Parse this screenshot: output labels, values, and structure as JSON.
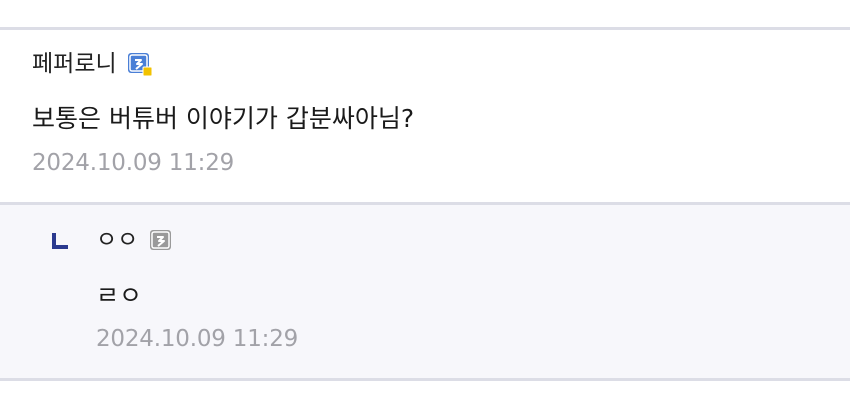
{
  "comments": [
    {
      "author": "페퍼로니",
      "author_icon": "gonick-fixed-icon",
      "text": "보통은 버튜버 이야기가 갑분싸아님?",
      "date": "2024.10.09 11:29"
    }
  ],
  "replies": [
    {
      "reply_marker_icon": "reply-arrow-icon",
      "author": "ㅇㅇ",
      "author_icon": "gonick-icon",
      "text": "ㄹㅇ",
      "date": "2024.10.09 11:29"
    }
  ],
  "colors": {
    "divider": "#dcdde6",
    "reply_background": "#f7f7fb",
    "date_text": "#a2a2a8",
    "reply_marker": "#2b3a8f",
    "fixed_nick_icon": "#4a7fd6",
    "fixed_nick_badge": "#f2c200",
    "nick_icon": "#9a9a9a"
  }
}
